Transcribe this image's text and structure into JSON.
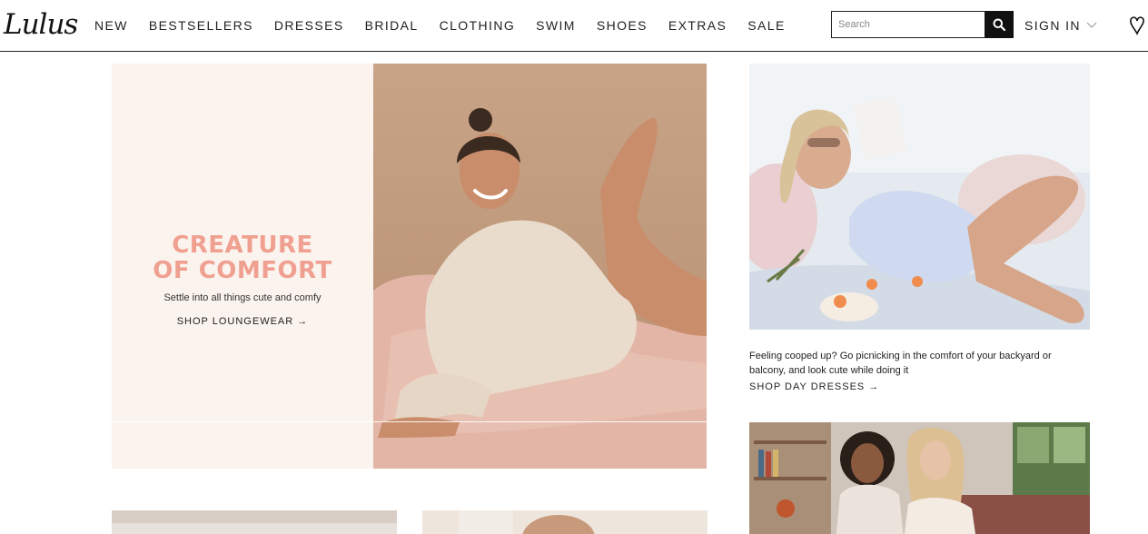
{
  "header": {
    "logo": "Lulus",
    "nav": [
      "NEW",
      "BESTSELLERS",
      "DRESSES",
      "BRIDAL",
      "CLOTHING",
      "SWIM",
      "SHOES",
      "EXTRAS",
      "SALE"
    ],
    "search_placeholder": "Search",
    "sign_in": "SIGN IN"
  },
  "hero": {
    "title_line1": "CREATURE",
    "title_line2": "OF COMFORT",
    "subtitle": "Settle into all things cute and comfy",
    "cta": "SHOP LOUNGEWEAR →",
    "title_color": "#f0a090"
  },
  "side1": {
    "caption": "Feeling cooped up? Go picnicking in the comfort of your backyard or balcony, and look cute while doing it",
    "cta": "SHOP DAY DRESSES →"
  }
}
